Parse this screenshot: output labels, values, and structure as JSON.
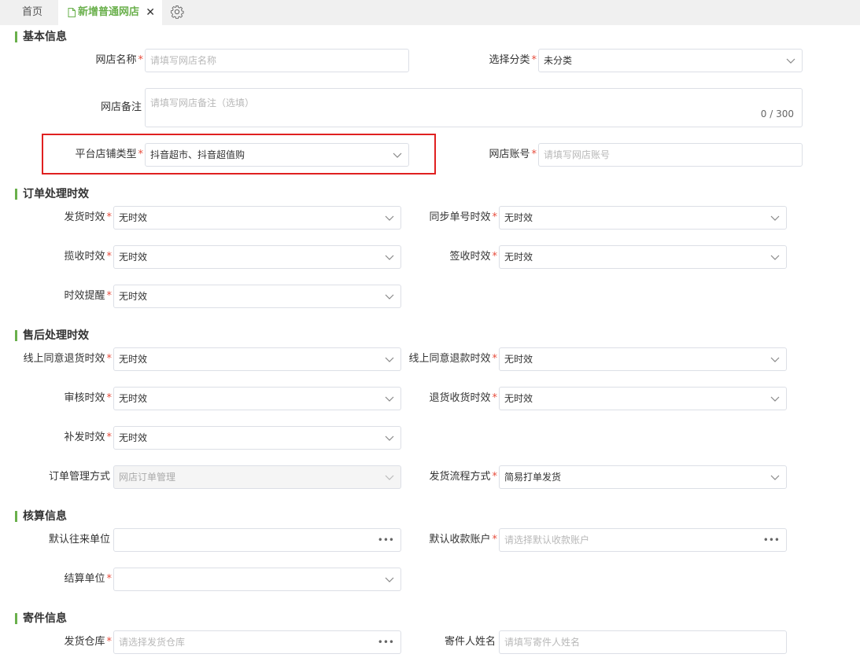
{
  "tabs": {
    "home": "首页",
    "active": "新增普通网店",
    "close": "✕"
  },
  "basic": {
    "title": "基本信息",
    "shop_name": {
      "label": "网店名称",
      "placeholder": "请填写网店名称"
    },
    "category": {
      "label": "选择分类",
      "value": "未分类"
    },
    "remark": {
      "label": "网店备注",
      "placeholder": "请填写网店备注（选填）",
      "count": "0 / 300"
    },
    "platform_type": {
      "label": "平台店铺类型",
      "value": "抖音超市、抖音超值购"
    },
    "account": {
      "label": "网店账号",
      "placeholder": "请填写网店账号"
    }
  },
  "order": {
    "title": "订单处理时效",
    "ship": {
      "label": "发货时效",
      "value": "无时效"
    },
    "sync": {
      "label": "同步单号时效",
      "value": "无时效"
    },
    "pickup": {
      "label": "揽收时效",
      "value": "无时效"
    },
    "sign": {
      "label": "签收时效",
      "value": "无时效"
    },
    "remind": {
      "label": "时效提醒",
      "value": "无时效"
    }
  },
  "aftersale": {
    "title": "售后处理时效",
    "return_agree": {
      "label": "线上同意退货时效",
      "value": "无时效"
    },
    "refund_agree": {
      "label": "线上同意退款时效",
      "value": "无时效"
    },
    "audit": {
      "label": "审核时效",
      "value": "无时效"
    },
    "return_receive": {
      "label": "退货收货时效",
      "value": "无时效"
    },
    "reissue": {
      "label": "补发时效",
      "value": "无时效"
    },
    "order_mgmt": {
      "label": "订单管理方式",
      "value": "网店订单管理"
    },
    "ship_flow": {
      "label": "发货流程方式",
      "value": "简易打单发货"
    }
  },
  "accounting": {
    "title": "核算信息",
    "default_unit": {
      "label": "默认往来单位",
      "value": ""
    },
    "default_account": {
      "label": "默认收款账户",
      "placeholder": "请选择默认收款账户"
    },
    "settle_unit": {
      "label": "结算单位",
      "value": ""
    }
  },
  "shipping": {
    "title": "寄件信息",
    "warehouse": {
      "label": "发货仓库",
      "placeholder": "请选择发货仓库"
    },
    "sender_name": {
      "label": "寄件人姓名",
      "placeholder": "请填写寄件人姓名"
    }
  },
  "required_mark": "*",
  "more_icon": "•••",
  "colors": {
    "accent": "#6ab04c",
    "required": "#e74c3c",
    "highlight": "#e02020"
  }
}
